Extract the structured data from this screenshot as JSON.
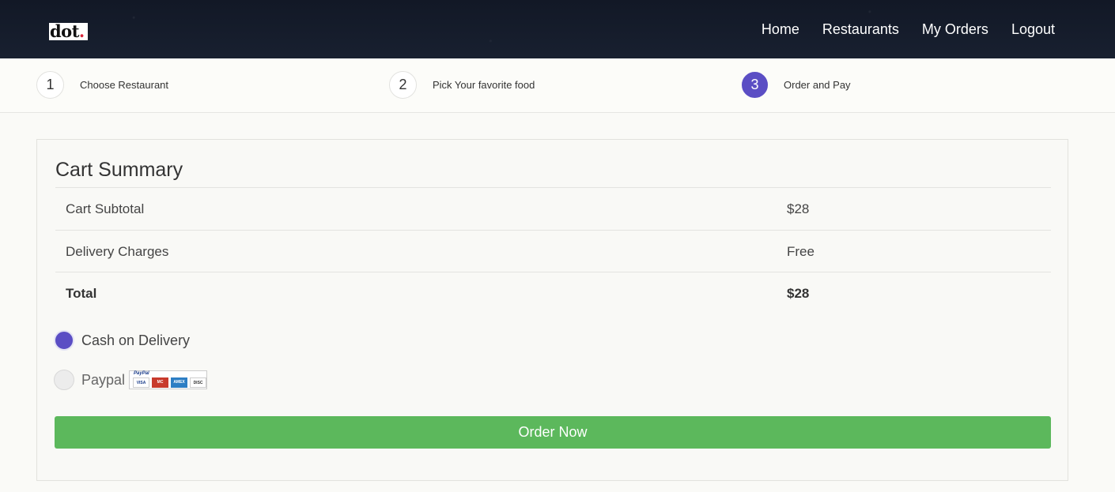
{
  "header": {
    "logo_text": "dot",
    "logo_dot": ".",
    "nav": [
      "Home",
      "Restaurants",
      "My Orders",
      "Logout"
    ]
  },
  "steps": [
    {
      "num": "1",
      "label": "Choose Restaurant"
    },
    {
      "num": "2",
      "label": "Pick Your favorite food"
    },
    {
      "num": "3",
      "label": "Order and Pay"
    }
  ],
  "cart": {
    "title": "Cart Summary",
    "rows": [
      {
        "label": "Cart Subtotal",
        "value": "$28"
      },
      {
        "label": "Delivery Charges",
        "value": "Free"
      },
      {
        "label": "Total",
        "value": "$28"
      }
    ]
  },
  "payment": {
    "options": [
      {
        "label": "Cash on Delivery",
        "selected": true
      },
      {
        "label": "Paypal",
        "selected": false
      }
    ],
    "paypal_badge": {
      "brand": "PayPal",
      "cards": [
        "VISA",
        "MasterCard",
        "AMEX",
        "DISCOVER"
      ]
    }
  },
  "order_button": "Order Now",
  "colors": {
    "accent": "#5b4ec4",
    "button": "#5cb85c",
    "header_bg": "#141a26"
  }
}
